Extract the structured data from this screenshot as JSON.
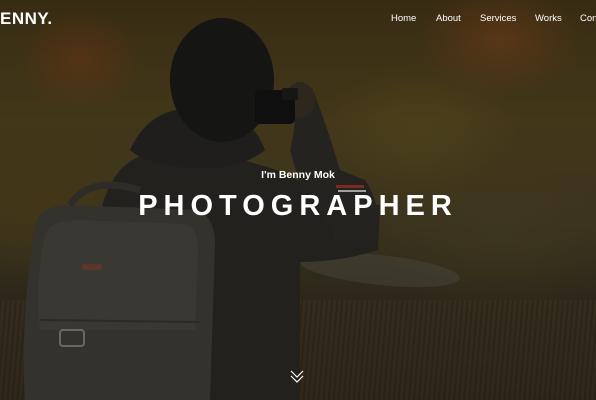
{
  "brand": {
    "logo_text": "ENNY."
  },
  "nav": {
    "items": [
      {
        "label": "Home"
      },
      {
        "label": "About"
      },
      {
        "label": "Services"
      },
      {
        "label": "Works"
      },
      {
        "label": "Con"
      }
    ]
  },
  "hero": {
    "intro": "I'm Benny Mok",
    "headline": "PHOTOGRAPHER",
    "scroll_icon": "chevron-down-double-icon"
  },
  "colors": {
    "text": "#ffffff",
    "overlay": "rgba(0,0,0,0.25)"
  }
}
